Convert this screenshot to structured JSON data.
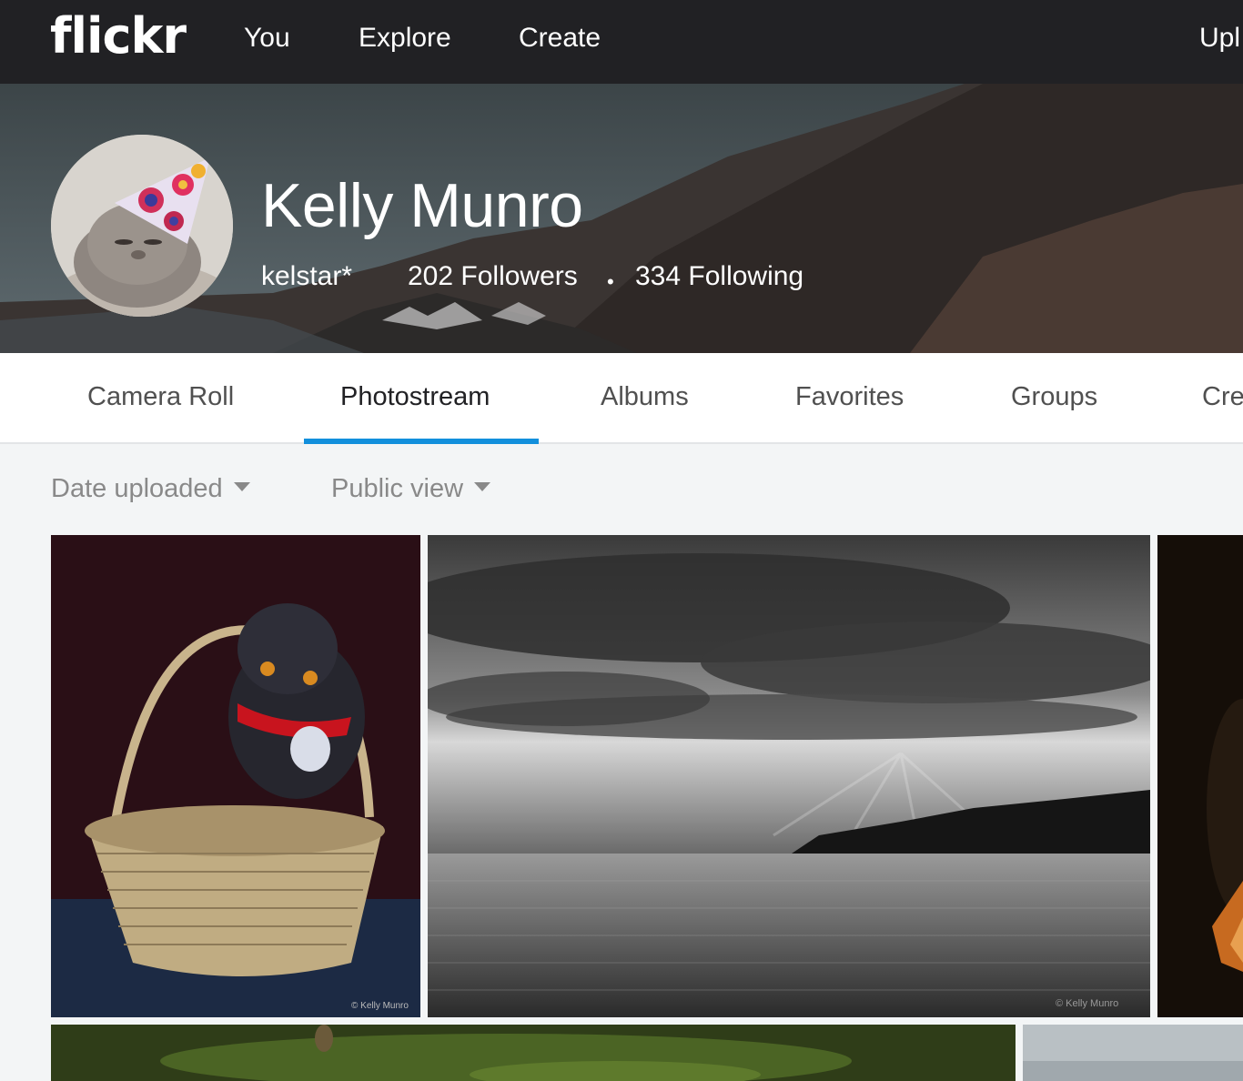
{
  "nav": {
    "logo": "flickr",
    "links": [
      "You",
      "Explore",
      "Create"
    ],
    "upload": "Upl"
  },
  "profile": {
    "name": "Kelly Munro",
    "username": "kelstar*",
    "followers": "202 Followers",
    "separator": "•",
    "following": "334 Following"
  },
  "tabs": {
    "items": [
      "Camera Roll",
      "Photostream",
      "Albums",
      "Favorites",
      "Groups",
      "Cre"
    ],
    "active": "Photostream"
  },
  "filters": {
    "sort": "Date uploaded",
    "view": "Public view"
  },
  "photos": {
    "credit_1": "© Kelly Munro",
    "credit_2": "© Kelly Munro"
  },
  "colors": {
    "nav_bg": "#212124",
    "accent": "#128fdc",
    "page_bg": "#f3f5f6"
  }
}
